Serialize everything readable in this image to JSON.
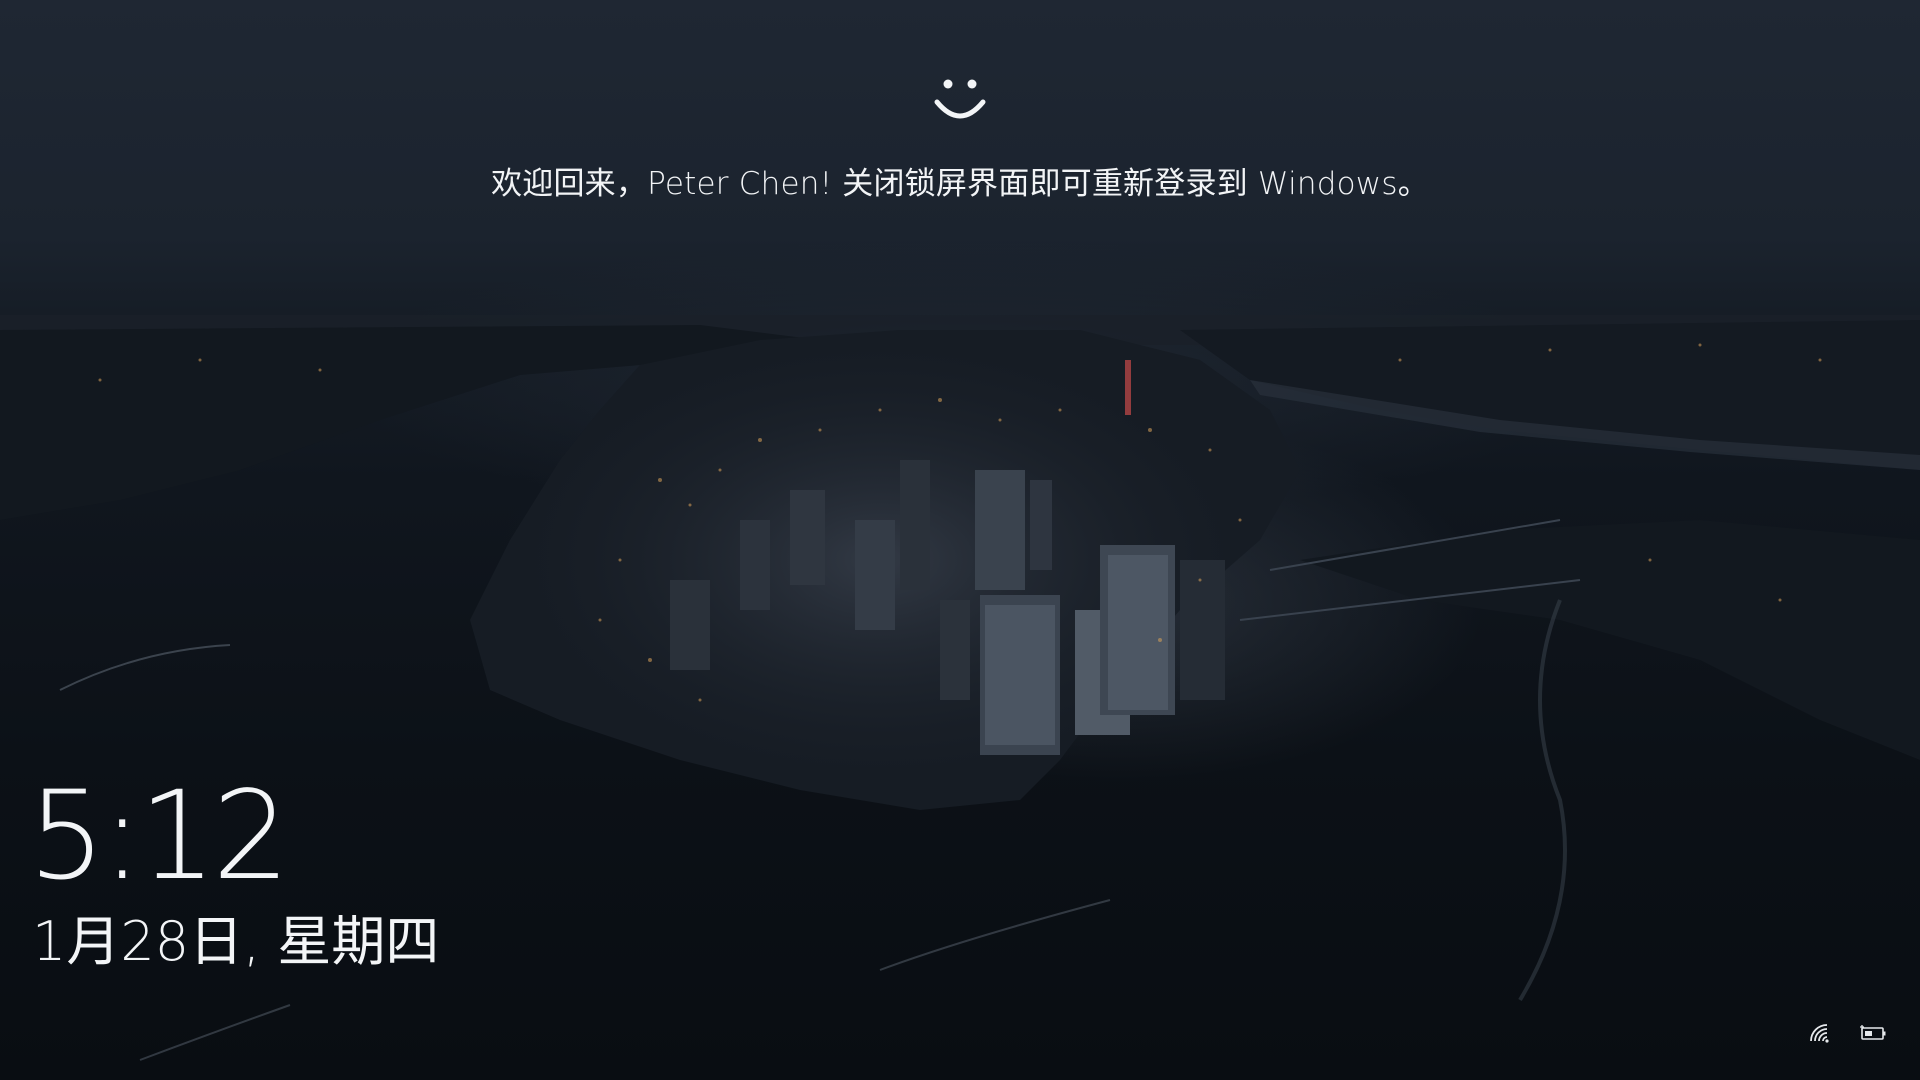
{
  "lock_screen": {
    "welcome_message": "欢迎回来，Peter Chen! 关闭锁屏界面即可重新登录到 Windows。",
    "time": "5:12",
    "date": "1月28日, 星期四",
    "hello_icon": "windows-hello-smiley-icon"
  },
  "system_tray": {
    "icons": [
      "network-icon",
      "battery-charging-icon"
    ]
  },
  "colors": {
    "text": "#f3f5f7",
    "sky": "#1f2733",
    "water": "#0c1117",
    "city_lights": "#d9a25a"
  }
}
